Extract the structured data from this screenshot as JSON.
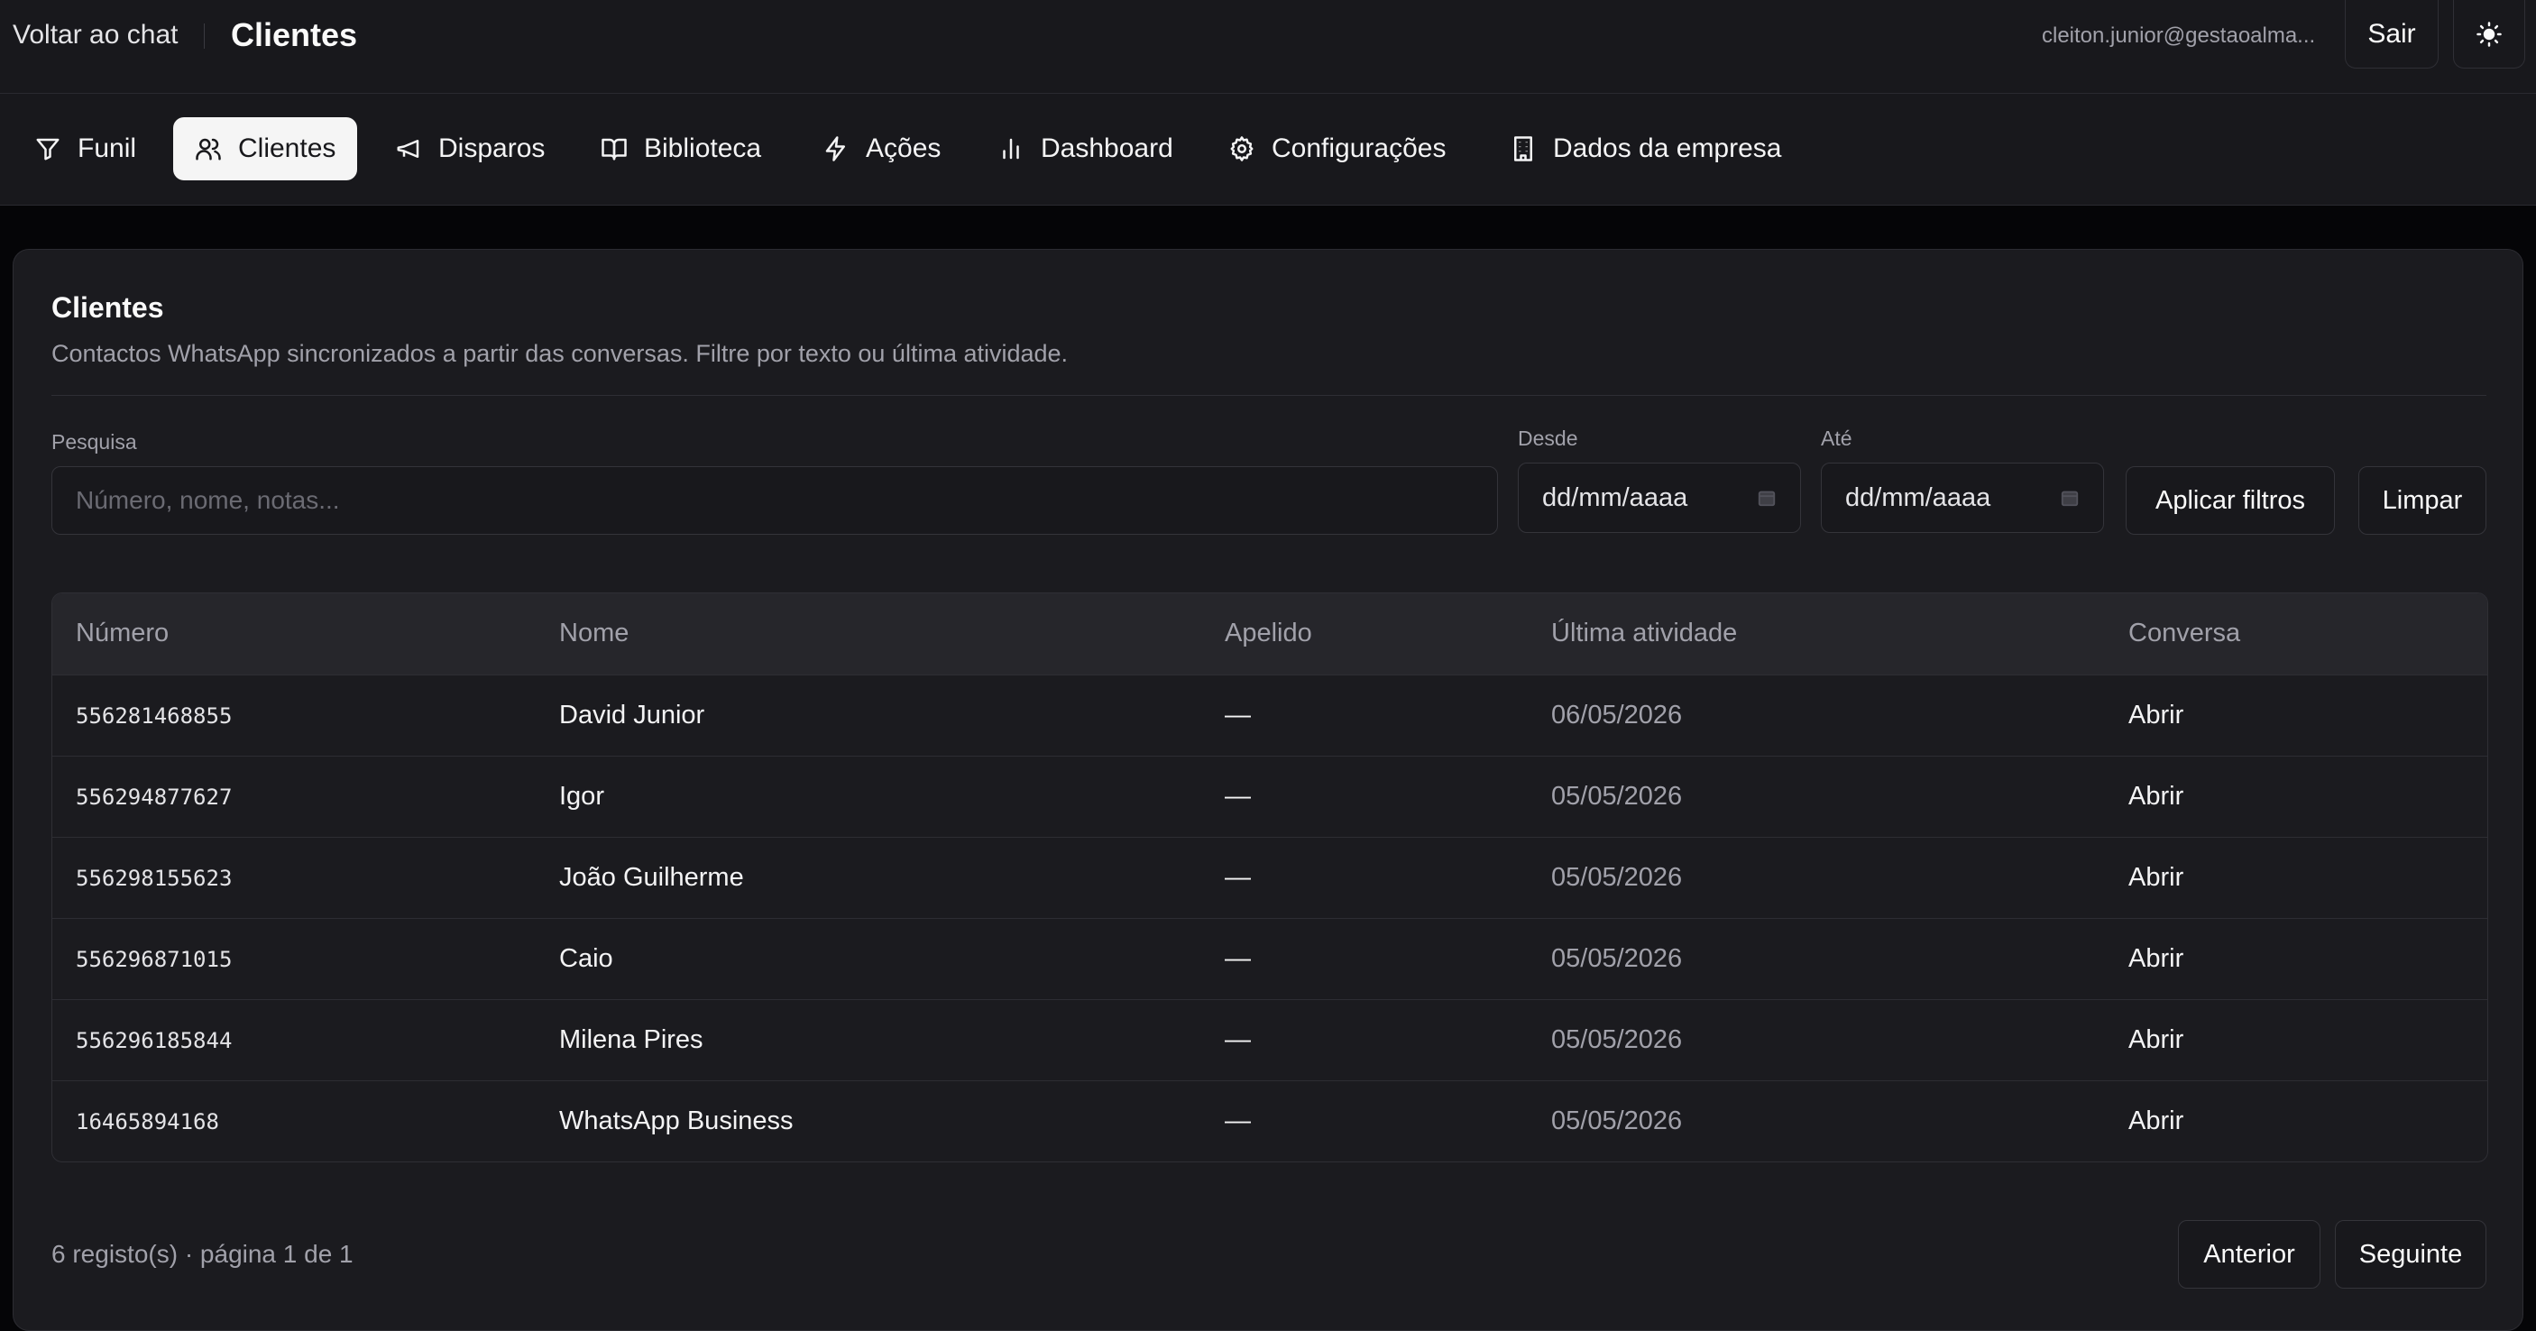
{
  "topbar": {
    "back_label": "Voltar ao chat",
    "title": "Clientes",
    "user_email": "cleiton.junior@gestaoalma...",
    "logout_label": "Sair"
  },
  "nav": {
    "tabs": [
      {
        "label": "Funil",
        "icon": "filter-icon",
        "active": false
      },
      {
        "label": "Clientes",
        "icon": "users-icon",
        "active": true
      },
      {
        "label": "Disparos",
        "icon": "megaphone-icon",
        "active": false
      },
      {
        "label": "Biblioteca",
        "icon": "book-icon",
        "active": false
      },
      {
        "label": "Ações",
        "icon": "zap-icon",
        "active": false
      },
      {
        "label": "Dashboard",
        "icon": "bar-chart-icon",
        "active": false
      },
      {
        "label": "Configurações",
        "icon": "gear-icon",
        "active": false
      },
      {
        "label": "Dados da empresa",
        "icon": "building-icon",
        "active": false
      }
    ]
  },
  "card": {
    "title": "Clientes",
    "description": "Contactos WhatsApp sincronizados a partir das conversas. Filtre por texto ou última atividade."
  },
  "filters": {
    "search_label": "Pesquisa",
    "search_placeholder": "Número, nome, notas...",
    "search_value": "",
    "from_label": "Desde",
    "from_placeholder": "dd/mm/aaaa",
    "to_label": "Até",
    "to_placeholder": "dd/mm/aaaa",
    "apply_label": "Aplicar filtros",
    "clear_label": "Limpar"
  },
  "table": {
    "columns": [
      "Número",
      "Nome",
      "Apelido",
      "Última atividade",
      "Conversa"
    ],
    "rows": [
      {
        "numero": "556281468855",
        "nome": "David Junior",
        "apelido": "—",
        "ultima": "06/05/2026",
        "conversa": "Abrir"
      },
      {
        "numero": "556294877627",
        "nome": "Igor",
        "apelido": "—",
        "ultima": "05/05/2026",
        "conversa": "Abrir"
      },
      {
        "numero": "556298155623",
        "nome": "João Guilherme",
        "apelido": "—",
        "ultima": "05/05/2026",
        "conversa": "Abrir"
      },
      {
        "numero": "556296871015",
        "nome": "Caio",
        "apelido": "—",
        "ultima": "05/05/2026",
        "conversa": "Abrir"
      },
      {
        "numero": "556296185844",
        "nome": "Milena Pires",
        "apelido": "—",
        "ultima": "05/05/2026",
        "conversa": "Abrir"
      },
      {
        "numero": "16465894168",
        "nome": "WhatsApp Business",
        "apelido": "—",
        "ultima": "05/05/2026",
        "conversa": "Abrir"
      }
    ]
  },
  "pagination": {
    "info": "6 registo(s) · página 1 de 1",
    "prev_label": "Anterior",
    "next_label": "Seguinte"
  },
  "colors": {
    "background": "#050507",
    "surface": "#18181c",
    "card": "#1b1b1f",
    "active_tab": "#f5f5f5",
    "muted_text": "#a1a1aa"
  }
}
